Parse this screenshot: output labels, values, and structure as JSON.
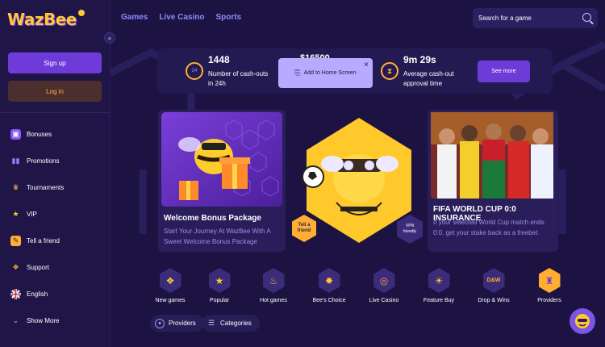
{
  "brand": {
    "logo_text": "WazBee"
  },
  "topnav": {
    "items": [
      "Games",
      "Live Casino",
      "Sports"
    ]
  },
  "search": {
    "placeholder": "Search for a game"
  },
  "sidebar": {
    "signup_label": "Sign up",
    "login_label": "Log in",
    "items": [
      {
        "label": "Bonuses",
        "icon": "gift-icon"
      },
      {
        "label": "Promotions",
        "icon": "podium-icon"
      },
      {
        "label": "Tournaments",
        "icon": "trophy-icon"
      },
      {
        "label": "VIP",
        "icon": "star-icon"
      },
      {
        "label": "Tell a friend",
        "icon": "share-icon"
      },
      {
        "label": "Support",
        "icon": "support-icon"
      },
      {
        "label": "English",
        "icon": "uk-flag-icon"
      },
      {
        "label": "Show More",
        "icon": "chevron-down-icon"
      }
    ]
  },
  "stats": {
    "cashouts_value": "1448",
    "cashouts_label": "Number of cash-outs in 24h",
    "ring_value": "24",
    "amount_partial": "$16500",
    "time_value": "9m 29s",
    "time_label": "Average cash-out approval time",
    "see_more_label": "See more"
  },
  "add_to_home": {
    "label": "Add to Home Screen",
    "close": "×"
  },
  "cards": {
    "welcome": {
      "title": "Welcome Bonus Package",
      "desc": "Start Your Journey At WazBee With A Sweet Welcome Bonus Package"
    },
    "tell_friend_badge": "Tell a friend",
    "vpn_badge": "VPN friendly",
    "fifa": {
      "title": "FIFA WORLD CUP 0:0 INSURANCE",
      "desc": "If your selected World Cup match ends 0:0, get your stake back as a freebet"
    }
  },
  "categories": [
    {
      "label": "New games",
      "icon": "new-games-icon"
    },
    {
      "label": "Popular",
      "icon": "popular-star-icon"
    },
    {
      "label": "Hot games",
      "icon": "flame-icon"
    },
    {
      "label": "Bee's Choice",
      "icon": "bee-badge-icon"
    },
    {
      "label": "Live Casino",
      "icon": "roulette-icon"
    },
    {
      "label": "Feature Buy",
      "icon": "sun-icon"
    },
    {
      "label": "Drop & Wins",
      "icon": "drop-wins-icon"
    },
    {
      "label": "Providers",
      "icon": "providers-icon"
    }
  ],
  "pills": {
    "providers": "Providers",
    "categories": "Categories"
  },
  "colors": {
    "background": "#1c1342",
    "accent_purple": "#6e3bd8",
    "accent_orange": "#ffae32",
    "nav_link": "#8b8cff"
  }
}
